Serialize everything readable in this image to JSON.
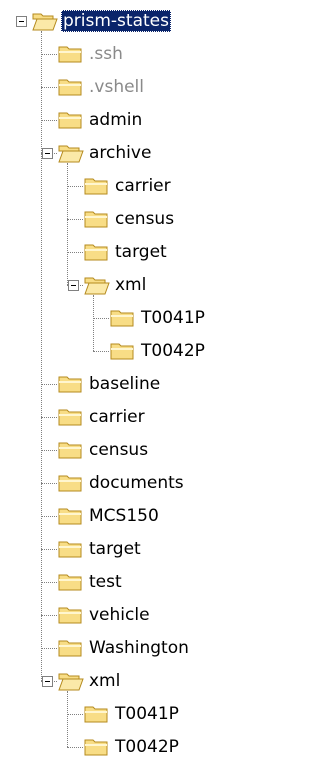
{
  "colors": {
    "selection_bg": "#0a246a",
    "selection_text": "#ffffff",
    "hidden_text": "#8a8a8a",
    "folder_fill": "#f8dd86",
    "folder_edge": "#b48a1e",
    "connector": "#808080"
  },
  "tree": {
    "nodes": [
      {
        "label": "prism-states",
        "depth": 0,
        "expanded": true,
        "selected": true,
        "icon": "folder-open-icon"
      },
      {
        "label": ".ssh",
        "depth": 1,
        "hidden": true,
        "icon": "folder-icon"
      },
      {
        "label": ".vshell",
        "depth": 1,
        "hidden": true,
        "icon": "folder-icon"
      },
      {
        "label": "admin",
        "depth": 1,
        "icon": "folder-icon"
      },
      {
        "label": "archive",
        "depth": 1,
        "expanded": true,
        "icon": "folder-open-icon"
      },
      {
        "label": "carrier",
        "depth": 2,
        "icon": "folder-icon"
      },
      {
        "label": "census",
        "depth": 2,
        "icon": "folder-icon"
      },
      {
        "label": "target",
        "depth": 2,
        "icon": "folder-icon"
      },
      {
        "label": "xml",
        "depth": 2,
        "expanded": true,
        "icon": "folder-open-icon"
      },
      {
        "label": "T0041P",
        "depth": 3,
        "icon": "folder-icon"
      },
      {
        "label": "T0042P",
        "depth": 3,
        "icon": "folder-icon"
      },
      {
        "label": "baseline",
        "depth": 1,
        "icon": "folder-icon"
      },
      {
        "label": "carrier",
        "depth": 1,
        "icon": "folder-icon"
      },
      {
        "label": "census",
        "depth": 1,
        "icon": "folder-icon"
      },
      {
        "label": "documents",
        "depth": 1,
        "icon": "folder-icon"
      },
      {
        "label": "MCS150",
        "depth": 1,
        "icon": "folder-icon"
      },
      {
        "label": "target",
        "depth": 1,
        "icon": "folder-icon"
      },
      {
        "label": "test",
        "depth": 1,
        "icon": "folder-icon"
      },
      {
        "label": "vehicle",
        "depth": 1,
        "icon": "folder-icon"
      },
      {
        "label": "Washington",
        "depth": 1,
        "icon": "folder-icon"
      },
      {
        "label": "xml",
        "depth": 1,
        "expanded": true,
        "icon": "folder-open-icon"
      },
      {
        "label": "T0041P",
        "depth": 2,
        "icon": "folder-icon"
      },
      {
        "label": "T0042P",
        "depth": 2,
        "icon": "folder-icon"
      }
    ]
  }
}
